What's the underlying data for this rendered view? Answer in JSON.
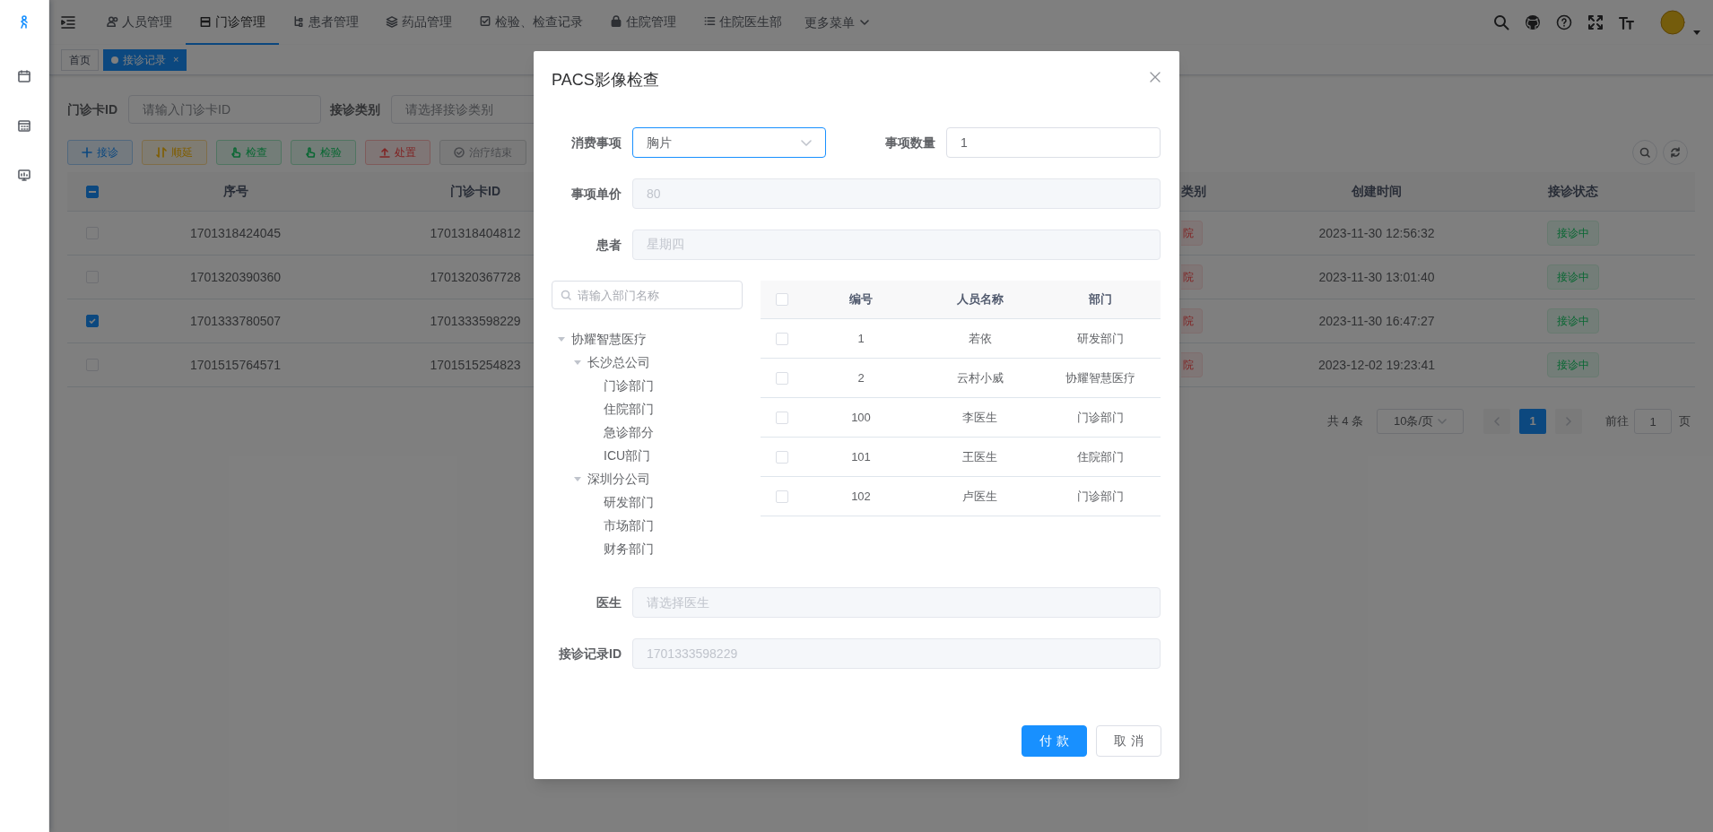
{
  "sidebar": {
    "items": [
      {
        "selected": true
      },
      {
        "selected": false
      },
      {
        "selected": false
      },
      {
        "selected": false
      }
    ]
  },
  "top_nav": {
    "items": [
      {
        "label": "人员管理",
        "selected": false
      },
      {
        "label": "门诊管理",
        "selected": true
      },
      {
        "label": "患者管理",
        "selected": false
      },
      {
        "label": "药品管理",
        "selected": false
      },
      {
        "label": "检验、检查记录",
        "selected": false
      },
      {
        "label": "住院管理",
        "selected": false
      },
      {
        "label": "住院医生部",
        "selected": false
      }
    ],
    "more": "更多菜单"
  },
  "tabs": [
    {
      "label": "首页",
      "selected": false
    },
    {
      "label": "接诊记录",
      "selected": true,
      "close": "×"
    }
  ],
  "filters": [
    {
      "label": "门诊卡ID",
      "placeholder": "请输入门诊卡ID"
    },
    {
      "label": "接诊类别",
      "placeholder": "请选择接诊类别"
    }
  ],
  "toolbar": [
    {
      "label": "接诊",
      "kind": "primary"
    },
    {
      "label": "顺延",
      "kind": "warning"
    },
    {
      "label": "检查",
      "kind": "success"
    },
    {
      "label": "检验",
      "kind": "success"
    },
    {
      "label": "处置",
      "kind": "danger"
    },
    {
      "label": "治疗结束",
      "kind": "info"
    }
  ],
  "table": {
    "header_indeterminate": true,
    "columns": [
      "序号",
      "门诊卡ID",
      "类别",
      "创建时间",
      "接诊状态"
    ],
    "rows": [
      {
        "checked": false,
        "cells": [
          {
            "kind": "text",
            "text": "1701318424045"
          },
          {
            "kind": "text",
            "text": "1701318404812"
          },
          {
            "kind": "danger",
            "text": "院"
          },
          {
            "kind": "text",
            "text": "2023-11-30 12:56:32"
          },
          {
            "kind": "success",
            "text": "接诊中"
          }
        ]
      },
      {
        "checked": false,
        "cells": [
          {
            "kind": "text",
            "text": "1701320390360"
          },
          {
            "kind": "text",
            "text": "1701320367728"
          },
          {
            "kind": "danger",
            "text": "院"
          },
          {
            "kind": "text",
            "text": "2023-11-30 13:01:40"
          },
          {
            "kind": "success",
            "text": "接诊中"
          }
        ]
      },
      {
        "checked": true,
        "cells": [
          {
            "kind": "text",
            "text": "1701333780507"
          },
          {
            "kind": "text",
            "text": "1701333598229"
          },
          {
            "kind": "danger",
            "text": "院"
          },
          {
            "kind": "text",
            "text": "2023-11-30 16:47:27"
          },
          {
            "kind": "success",
            "text": "接诊中"
          }
        ]
      },
      {
        "checked": false,
        "cells": [
          {
            "kind": "text",
            "text": "1701515764571"
          },
          {
            "kind": "text",
            "text": "1701515254823"
          },
          {
            "kind": "danger",
            "text": "院"
          },
          {
            "kind": "text",
            "text": "2023-12-02 19:23:41"
          },
          {
            "kind": "success",
            "text": "接诊中"
          }
        ]
      }
    ]
  },
  "pagination": {
    "total": "共 4 条",
    "page_size": "10条/页",
    "pages": [
      {
        "label": "1",
        "selected": true
      }
    ],
    "goto_label": "前往",
    "goto_value": "1",
    "goto_suffix": "页"
  },
  "dialog": {
    "title": "PACS影像检查",
    "top_rows": [
      [
        {
          "label": "消费事项",
          "kind": "select",
          "value": "胸片",
          "disabled": false,
          "focused": true
        },
        {
          "label": "事项数量",
          "kind": "input",
          "value": "1",
          "disabled": false,
          "focused": false
        }
      ],
      [
        {
          "label": "事项单价",
          "kind": "input",
          "value": "80",
          "disabled": true
        }
      ],
      [
        {
          "label": "患者",
          "kind": "input",
          "value": "星期四",
          "disabled": true
        }
      ]
    ],
    "tree_search": {
      "placeholder": "请输入部门名称"
    },
    "tree": [
      {
        "label": "协耀智慧医疗",
        "expanded": true,
        "children": [
          {
            "label": "长沙总公司",
            "expanded": true,
            "children": [
              {
                "label": "门诊部门"
              },
              {
                "label": "住院部门"
              },
              {
                "label": "急诊部分"
              },
              {
                "label": "ICU部门"
              }
            ]
          },
          {
            "label": "深圳分公司",
            "expanded": true,
            "children": [
              {
                "label": "研发部门"
              },
              {
                "label": "市场部门"
              },
              {
                "label": "财务部门"
              }
            ]
          }
        ]
      }
    ],
    "staff_table": {
      "header_checked": false,
      "columns": [
        "编号",
        "人员名称",
        "部门"
      ],
      "rows": [
        {
          "checked": false,
          "cells": [
            "1",
            "若依",
            "研发部门"
          ]
        },
        {
          "checked": false,
          "cells": [
            "2",
            "云村小威",
            "协耀智慧医疗"
          ]
        },
        {
          "checked": false,
          "cells": [
            "100",
            "李医生",
            "门诊部门"
          ]
        },
        {
          "checked": false,
          "cells": [
            "101",
            "王医生",
            "住院部门"
          ]
        },
        {
          "checked": false,
          "cells": [
            "102",
            "卢医生",
            "门诊部门"
          ]
        }
      ]
    },
    "bottom_fields": [
      {
        "label": "医生",
        "placeholder": "请选择医生",
        "disabled": true
      },
      {
        "label": "接诊记录ID",
        "value": "1701333598229",
        "disabled": true
      }
    ],
    "buttons": [
      {
        "label": "付款",
        "kind": "primary"
      },
      {
        "label": "取消",
        "kind": "default"
      }
    ]
  }
}
